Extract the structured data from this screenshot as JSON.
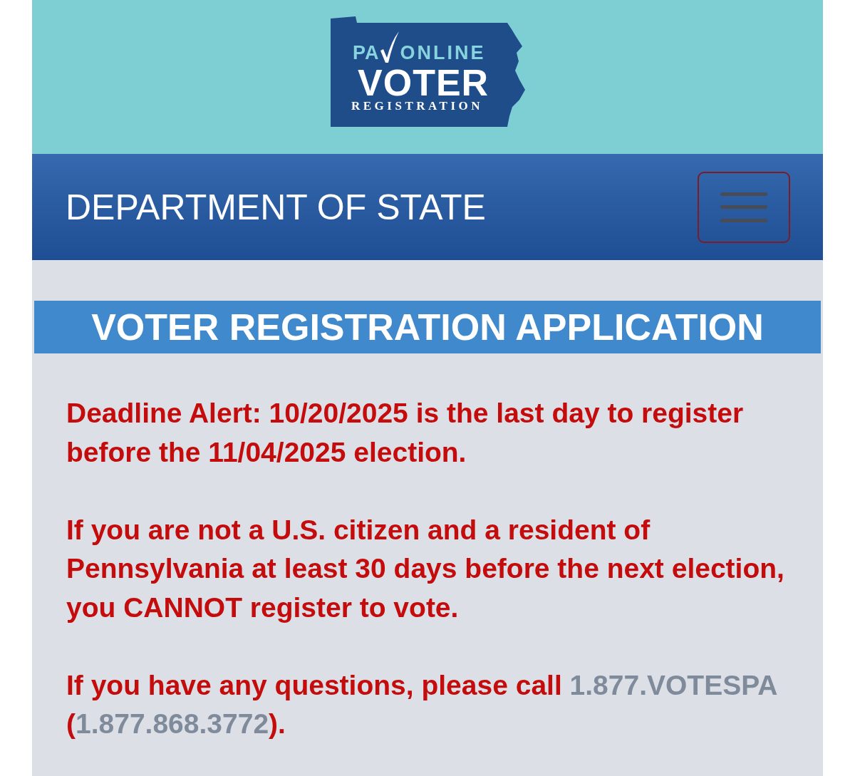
{
  "header": {
    "logo": {
      "abbreviation": "PA",
      "line_1": "ONLINE",
      "line_2": "VOTER",
      "line_3": "REGISTRATION"
    }
  },
  "navbar": {
    "title": "DEPARTMENT OF STATE"
  },
  "heading": "VOTER REGISTRATION APPLICATION",
  "paragraphs": [
    {
      "segments": [
        {
          "kind": "text",
          "text": "Deadline Alert: 10/20/2025 is the last day to register before the 11/04/2025 election."
        }
      ]
    },
    {
      "segments": [
        {
          "kind": "text",
          "text": "If you are not a U.S. citizen and a resident of Pennsylvania at least 30 days before the next election, you CANNOT register to vote."
        }
      ]
    },
    {
      "segments": [
        {
          "kind": "text",
          "text": "If you have any questions, please call "
        },
        {
          "kind": "link",
          "text": "1.877.VOTESPA"
        },
        {
          "kind": "text",
          "text": " ("
        },
        {
          "kind": "link",
          "text": "1.877.868.3772"
        },
        {
          "kind": "text",
          "text": ")."
        }
      ]
    }
  ]
}
